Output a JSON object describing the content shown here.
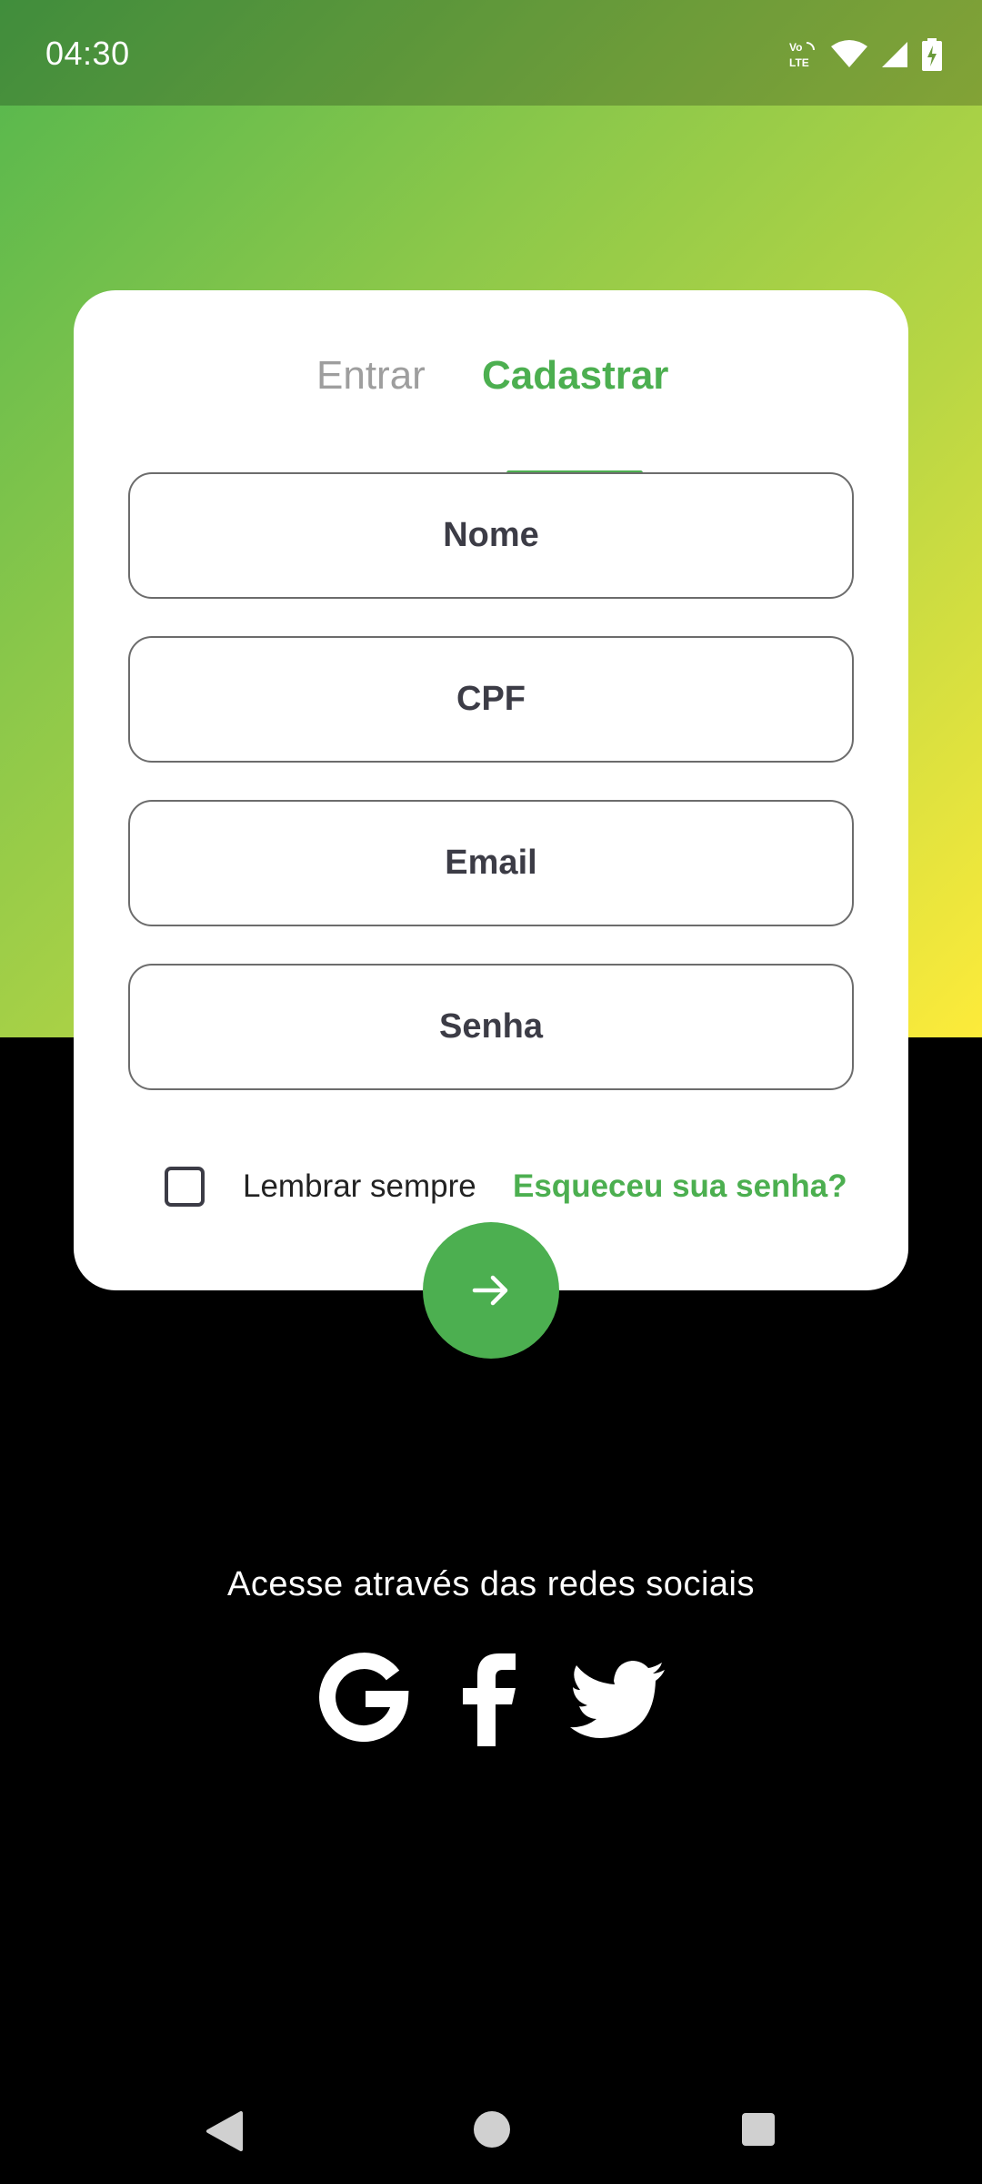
{
  "status_bar": {
    "time": "04:30",
    "volte_label": "Vo \nLTE",
    "icons": [
      "volte-icon",
      "wifi-icon",
      "signal-icon",
      "battery-charging-icon"
    ]
  },
  "auth_card": {
    "tabs": [
      {
        "label": "Entrar",
        "active": false
      },
      {
        "label": "Cadastrar",
        "active": true
      }
    ],
    "fields": {
      "name_placeholder": "Nome",
      "cpf_placeholder": "CPF",
      "email_placeholder": "Email",
      "password_placeholder": "Senha"
    },
    "remember_label": "Lembrar sempre",
    "remember_checked": false,
    "forgot_link": "Esqueceu sua senha?",
    "submit_icon": "arrow-right-icon"
  },
  "social": {
    "title": "Acesse através das redes sociais",
    "providers": [
      "google-icon",
      "facebook-icon",
      "twitter-icon"
    ]
  },
  "nav_bar": {
    "buttons": [
      "back-icon",
      "home-icon",
      "recent-apps-icon"
    ]
  },
  "colors": {
    "accent": "#4caf50",
    "gradient_start": "#53b64e",
    "gradient_end": "#fdeb3a",
    "inactive_tab": "#9e9e9e",
    "background": "#000000"
  }
}
